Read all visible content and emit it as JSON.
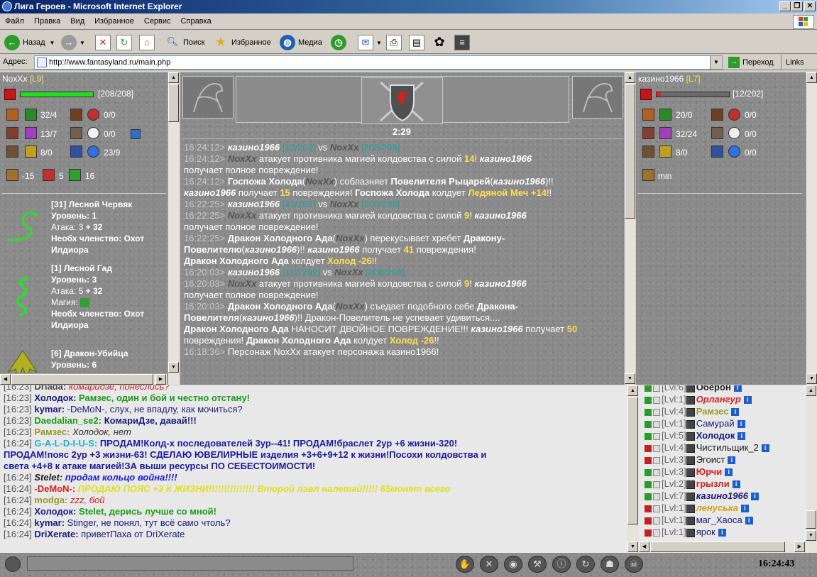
{
  "window": {
    "title": "Лига Героев - Microsoft Internet Explorer",
    "buttons": [
      "_",
      "❐",
      "✕"
    ]
  },
  "menu": [
    "Файл",
    "Правка",
    "Вид",
    "Избранное",
    "Сервис",
    "Справка"
  ],
  "toolbar": {
    "back": "Назад",
    "search": "Поиск",
    "favorites": "Избранное",
    "media": "Медиа"
  },
  "address": {
    "label": "Адрес:",
    "url": "http://www.fantasyland.ru/main.php",
    "go": "Переход",
    "links": "Links"
  },
  "player_left": {
    "name": "NoxXx",
    "level": "[L9]",
    "hp": "[208/208]",
    "hp_fraction": 1.0,
    "stats": [
      {
        "a": "32/4",
        "b": "0/0"
      },
      {
        "a": "13/7",
        "b": "0/0"
      },
      {
        "a": "8/0",
        "b": "23/9"
      }
    ],
    "extra": [
      "-15",
      "5",
      "16"
    ],
    "creatures": [
      {
        "title": "[31] Лесной Червяк",
        "level": "Уровень: 1",
        "attack": "Атака: 3",
        "attack_bonus": "+ 32",
        "req": "Необх членство: Охот",
        "guild": "Илдиора"
      },
      {
        "title": "[1] Лесной Гад",
        "level": "Уровень: 3",
        "attack": "Атака: 5",
        "attack_bonus": "+ 32",
        "magic": "Магия:",
        "req": "Необх членство: Охот",
        "guild": "Илдиора"
      },
      {
        "title": "[6] Дракон-Убийца",
        "level": "Уровень: 6"
      }
    ]
  },
  "player_right": {
    "name": "казино1966",
    "level": "[L7]",
    "hp": "[12/202]",
    "hp_fraction": 0.06,
    "stats": [
      {
        "a": "20/0",
        "b": "0/0"
      },
      {
        "a": "32/24",
        "b": "0/0"
      },
      {
        "a": "8/0",
        "b": "0/0"
      }
    ],
    "extra": "min"
  },
  "battle": {
    "timer": "2:29"
  },
  "log": [
    [
      {
        "c": "ts",
        "t": "16:24:12> "
      },
      {
        "c": "nm",
        "t": "казино1966"
      },
      {
        "c": "hp2",
        "t": " [12/202]"
      },
      {
        "c": "",
        "t": " vs "
      },
      {
        "c": "en",
        "t": "NoxXx"
      },
      {
        "c": "hp2",
        "t": " [208/208]"
      }
    ],
    [
      {
        "c": "ts",
        "t": "16:24:12> "
      },
      {
        "c": "en",
        "t": "NoxXx"
      },
      {
        "c": "",
        "t": " атакует противника магией колдовства с силой "
      },
      {
        "c": "yl",
        "t": "14"
      },
      {
        "c": "",
        "t": "! "
      },
      {
        "c": "nm",
        "t": "казино1966"
      }
    ],
    [
      {
        "c": "",
        "t": "получает полное повреждение!"
      }
    ],
    [
      {
        "c": "ts",
        "t": "16:24:12> "
      },
      {
        "c": "bw",
        "t": "Госпожа Холода"
      },
      {
        "c": "",
        "t": "("
      },
      {
        "c": "en",
        "t": "NoxXx"
      },
      {
        "c": "",
        "t": ") соблазняет "
      },
      {
        "c": "bw",
        "t": "Повелителя Рыцарей"
      },
      {
        "c": "",
        "t": "("
      },
      {
        "c": "nm",
        "t": "казино1966"
      },
      {
        "c": "",
        "t": ")!!"
      }
    ],
    [
      {
        "c": "nm",
        "t": "казино1966"
      },
      {
        "c": "",
        "t": " получает "
      },
      {
        "c": "yl",
        "t": "15"
      },
      {
        "c": "",
        "t": " повреждения! "
      },
      {
        "c": "bw",
        "t": "Госпожа Холода"
      },
      {
        "c": "",
        "t": " колдует "
      },
      {
        "c": "yl",
        "t": "Ледяной Меч +14"
      },
      {
        "c": "",
        "t": "!!"
      }
    ],
    [
      {
        "c": "ts",
        "t": "16:22:25> "
      },
      {
        "c": "nm",
        "t": "казино1966"
      },
      {
        "c": "hp2",
        "t": " [41/202]"
      },
      {
        "c": "",
        "t": " vs "
      },
      {
        "c": "en",
        "t": "NoxXx"
      },
      {
        "c": "hp2",
        "t": " [208/208]"
      }
    ],
    [
      {
        "c": "ts",
        "t": "16:22:25> "
      },
      {
        "c": "en",
        "t": "NoxXx"
      },
      {
        "c": "",
        "t": " атакует противника магией колдовства с силой "
      },
      {
        "c": "yl",
        "t": "9"
      },
      {
        "c": "",
        "t": "! "
      },
      {
        "c": "nm",
        "t": "казино1966"
      }
    ],
    [
      {
        "c": "",
        "t": "получает полное повреждение!"
      }
    ],
    [
      {
        "c": "ts",
        "t": "16:22:25> "
      },
      {
        "c": "bw",
        "t": "Дракон Холодного Ада"
      },
      {
        "c": "",
        "t": "("
      },
      {
        "c": "en",
        "t": "NoxXx"
      },
      {
        "c": "",
        "t": ") перекусывает хребет "
      },
      {
        "c": "bw",
        "t": "Дракону-"
      }
    ],
    [
      {
        "c": "bw",
        "t": "Повелителю"
      },
      {
        "c": "",
        "t": "("
      },
      {
        "c": "nm",
        "t": "казино1966"
      },
      {
        "c": "",
        "t": ")!! "
      },
      {
        "c": "nm",
        "t": "казино1966"
      },
      {
        "c": "",
        "t": " получает "
      },
      {
        "c": "yl",
        "t": "41"
      },
      {
        "c": "",
        "t": " повреждения!"
      }
    ],
    [
      {
        "c": "bw",
        "t": "Дракон Холодного Ада"
      },
      {
        "c": "",
        "t": " колдует "
      },
      {
        "c": "yl",
        "t": "Холод -26"
      },
      {
        "c": "",
        "t": "!!"
      }
    ],
    [
      {
        "c": "ts",
        "t": "16:20:03> "
      },
      {
        "c": "nm",
        "t": "казино1966"
      },
      {
        "c": "hp2",
        "t": " [117/202]"
      },
      {
        "c": "",
        "t": " vs "
      },
      {
        "c": "en",
        "t": "NoxXx"
      },
      {
        "c": "hp2",
        "t": " [208/208]"
      }
    ],
    [
      {
        "c": "ts",
        "t": "16:20:03> "
      },
      {
        "c": "en",
        "t": "NoxXx"
      },
      {
        "c": "",
        "t": " атакует противника магией колдовства с силой "
      },
      {
        "c": "yl",
        "t": "9"
      },
      {
        "c": "",
        "t": "! "
      },
      {
        "c": "nm",
        "t": "казино1966"
      }
    ],
    [
      {
        "c": "",
        "t": "получает полное повреждение!"
      }
    ],
    [
      {
        "c": "ts",
        "t": "16:20:03> "
      },
      {
        "c": "bw",
        "t": "Дракон Холодного Ада"
      },
      {
        "c": "",
        "t": "("
      },
      {
        "c": "en",
        "t": "NoxXx"
      },
      {
        "c": "",
        "t": ") съедает подобного себе "
      },
      {
        "c": "bw",
        "t": "Дракона-"
      }
    ],
    [
      {
        "c": "bw",
        "t": "Повелителя"
      },
      {
        "c": "",
        "t": "("
      },
      {
        "c": "nm",
        "t": "казино1966"
      },
      {
        "c": "",
        "t": ")!! Дракон-Повелитель не успевает удивиться...."
      }
    ],
    [
      {
        "c": "bw",
        "t": "Дракон Холодного Ада"
      },
      {
        "c": "",
        "t": " НАНОСИТ ДВОЙНОЕ ПОВРЕЖДЕНИЕ!!! "
      },
      {
        "c": "nm",
        "t": "казино1966"
      },
      {
        "c": "",
        "t": " получает "
      },
      {
        "c": "yl",
        "t": "50"
      }
    ],
    [
      {
        "c": "",
        "t": "повреждения! "
      },
      {
        "c": "bw",
        "t": "Дракон Холодного Ада"
      },
      {
        "c": "",
        "t": " колдует "
      },
      {
        "c": "yl",
        "t": "Холод -26"
      },
      {
        "c": "",
        "t": "!!"
      }
    ],
    [
      {
        "c": "ts",
        "t": "16:18:36> "
      },
      {
        "c": "",
        "t": "Персонаж NoxXx атакует персонажа казино1966!"
      }
    ]
  ],
  "chat": [
    {
      "time": "[16:23]",
      "nick": "Driada:",
      "nick_color": "#444",
      "text": "комаридзе, понеслись?",
      "text_color": "#c02020",
      "italic": true
    },
    {
      "time": "[16:23]",
      "nick": "Холодок:",
      "nick_color": "#1a1a7a",
      "text": "Рамзес, один и бой и честно отстану!",
      "text_color": "#1a9a1a",
      "bold": true
    },
    {
      "time": "[16:23]",
      "nick": "kymar:",
      "nick_color": "#1a1a7a",
      "text": "-DeMoN-, слух, не впадлу, как мочиться?",
      "text_color": "#1a1a7a"
    },
    {
      "time": "[16:23]",
      "nick": "Daedalian_se2:",
      "nick_color": "#1a9a1a",
      "text": "КомариДзе, давай!!!",
      "text_color": "#1a1a7a",
      "bold": true
    },
    {
      "time": "[16:23]",
      "nick": "Рамзес:",
      "nick_color": "#9a9a2a",
      "text": "Холодок, нет",
      "text_color": "#333",
      "italic": true
    },
    {
      "time": "[16:24]",
      "nick": "G-A-L-D-I-U-S:",
      "nick_color": "#20b0d0",
      "text": "ПРОДАМ!Колд-х последователей 3ур--41! ПРОДАМ!браслет 2ур +6 жизни-320!",
      "text_color": "#1a1a9a",
      "bold": true
    },
    {
      "time": "",
      "nick": "",
      "nick_color": "#1a1a9a",
      "text": "ПРОДАМ!пояс 2ур +3 жизни-63! СДЕЛАЮ ЮВЕЛИРНЫЕ изделия +3+6+9+12 к жизни!Посохи колдовства и",
      "text_color": "#1a1a9a",
      "bold": true
    },
    {
      "time": "",
      "nick": "",
      "nick_color": "#1a1a9a",
      "text": "света +4+8 к атаке магией!ЗА выши ресурсы ПО СЕБЕСТОИМОСТИ!",
      "text_color": "#1a1a9a",
      "bold": true
    },
    {
      "time": "[16:24]",
      "nick": "Stelet:",
      "nick_color": "#1a1a1a",
      "text": "продам кольцо война!!!!",
      "text_color": "#1a1ad0",
      "italic": true,
      "bold": true
    },
    {
      "time": "[16:24]",
      "nick": "-DeMoN-:",
      "nick_color": "#d02020",
      "text": "ПРОДАЮ ПОЯС +3 К ЖИЗНИ!!!!!!!!!!!!!!! Второй лэвл налетай!!!!! 65монет всего",
      "text_color": "#e0e020",
      "italic": true,
      "bold": true
    },
    {
      "time": "[16:24]",
      "nick": "modga:",
      "nick_color": "#9a9a2a",
      "text": "zzz, бой",
      "text_color": "#d02020",
      "italic": true
    },
    {
      "time": "[16:24]",
      "nick": "Холодок:",
      "nick_color": "#1a1a7a",
      "text": "Stelet, дерись лучше со мной!",
      "text_color": "#1a9a1a",
      "bold": true
    },
    {
      "time": "[16:24]",
      "nick": "kymar:",
      "nick_color": "#1a1a7a",
      "text": "Stinger, не понял, тут всё само чтоль?",
      "text_color": "#1a1a7a"
    },
    {
      "time": "[16:24]",
      "nick": "DriXerate:",
      "nick_color": "#1a1a7a",
      "text": "приветПаха от DriXerate",
      "text_color": "#1a1a7a"
    }
  ],
  "users": [
    {
      "lvl": "[Lvl:6]",
      "name": "Оберон",
      "color": "#1a1a1a",
      "bold": true,
      "flag": "green"
    },
    {
      "lvl": "[Lvl:1]",
      "name": "Орлангур",
      "color": "#d02020",
      "bold": true,
      "italic": true,
      "flag": "green"
    },
    {
      "lvl": "[Lvl:4]",
      "name": "Рамзес",
      "color": "#9a9a2a",
      "bold": true,
      "flag": "green"
    },
    {
      "lvl": "[Lvl:1]",
      "name": "Самурай",
      "color": "#1a1a7a",
      "flag": "green"
    },
    {
      "lvl": "[Lvl:5]",
      "name": "Холодок",
      "color": "#1a1a7a",
      "bold": true,
      "flag": "green"
    },
    {
      "lvl": "[Lvl:4]",
      "name": "Чистильщик_2",
      "color": "#1a1a1a",
      "flag": "red"
    },
    {
      "lvl": "[Lvl:3]",
      "name": "Эгоист",
      "color": "#1a1a1a",
      "flag": "red"
    },
    {
      "lvl": "[Lvl:3]",
      "name": "Юрчи",
      "color": "#d02020",
      "bold": true,
      "flag": "green"
    },
    {
      "lvl": "[Lvl:2]",
      "name": "грызли",
      "color": "#d02020",
      "bold": true,
      "flag": "green"
    },
    {
      "lvl": "[Lvl:7]",
      "name": "казино1966",
      "color": "#1a1a7a",
      "bold": true,
      "italic": true,
      "flag": "green"
    },
    {
      "lvl": "[Lvl:1]",
      "name": "ленуська",
      "color": "#d0a020",
      "bold": true,
      "italic": true,
      "flag": "red"
    },
    {
      "lvl": "[Lvl:1]",
      "name": "маг_Хаоса",
      "color": "#1a1a7a",
      "flag": "red"
    },
    {
      "lvl": "[Lvl:1]",
      "name": "ярок",
      "color": "#1a1a7a",
      "flag": "red"
    }
  ],
  "clock": "16:24:43"
}
